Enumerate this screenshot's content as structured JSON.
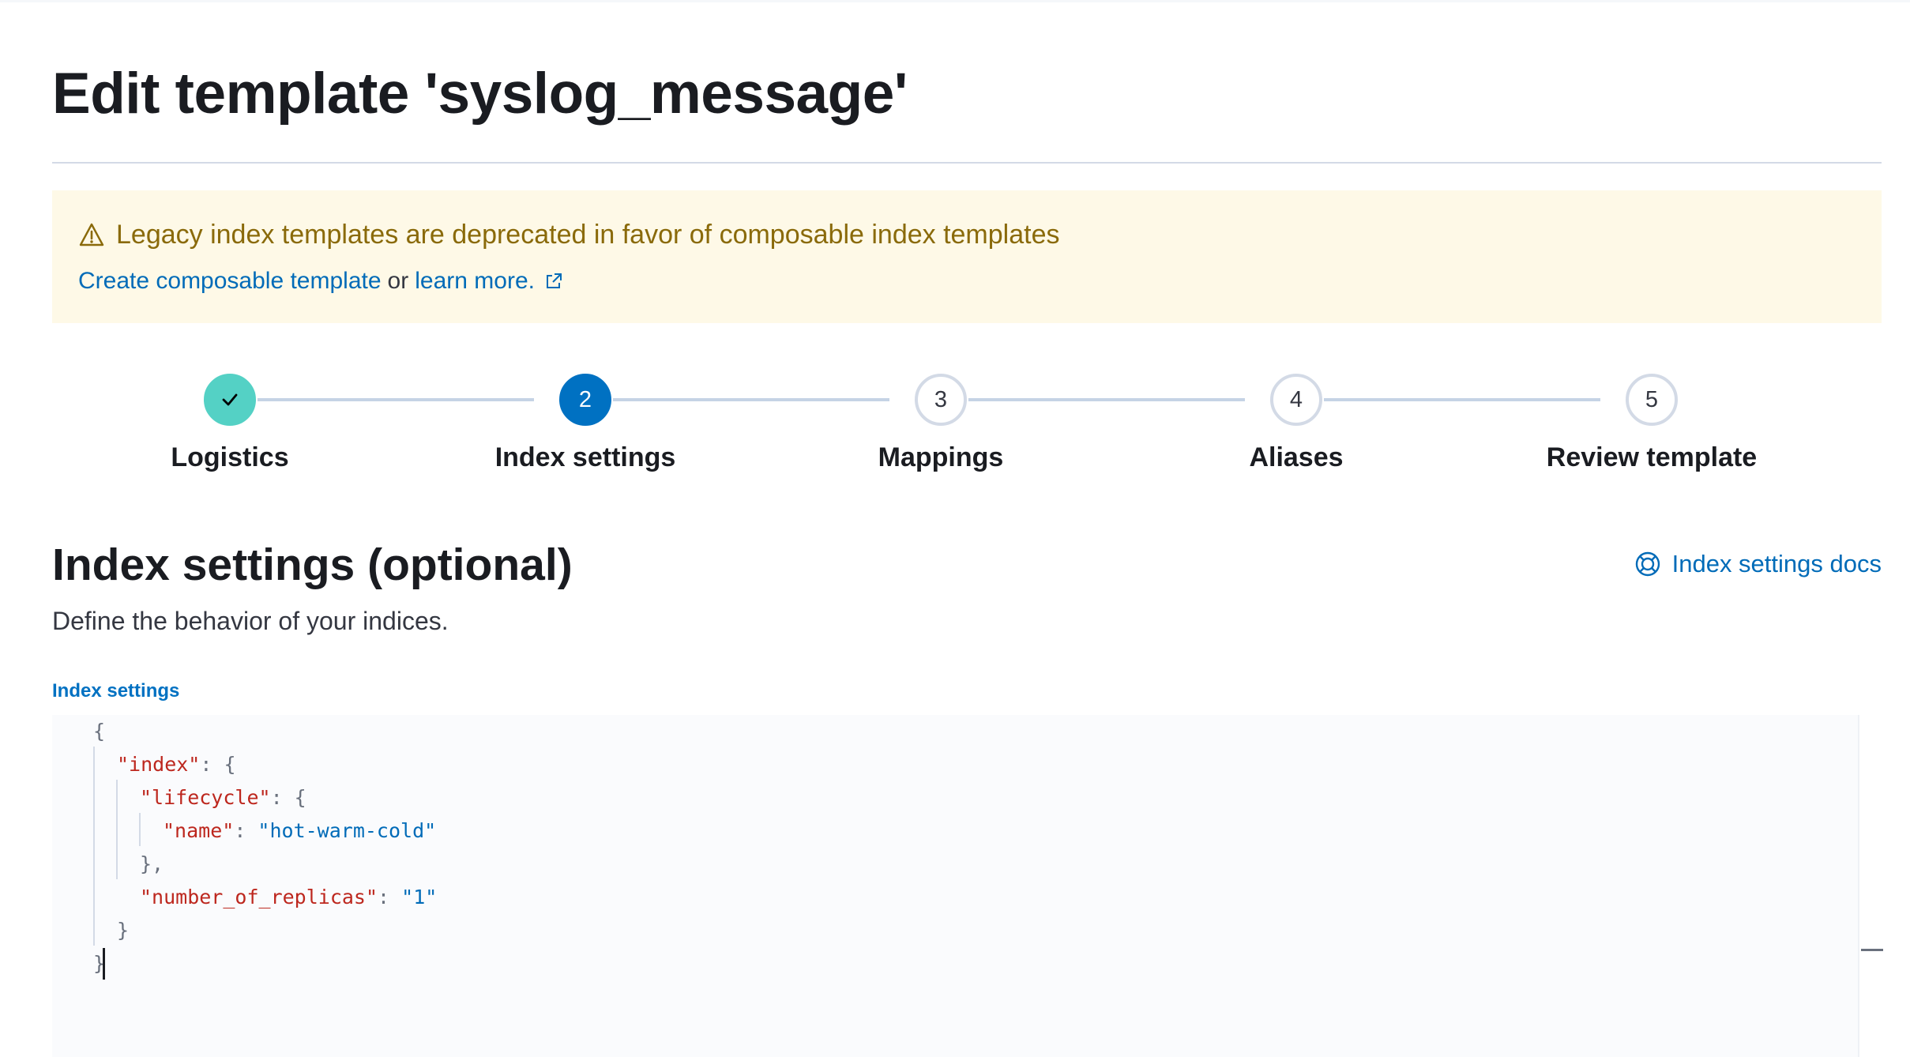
{
  "page": {
    "title": "Edit template 'syslog_message'"
  },
  "callout": {
    "title": "Legacy index templates are deprecated in favor of composable index templates",
    "create_link": "Create composable template",
    "connector": "or",
    "learn_link": "learn more.",
    "icon": "warning-icon",
    "link_icon": "external-link-icon",
    "colors": {
      "background": "#fef9e7",
      "text": "#8a6a0a"
    }
  },
  "steps": [
    {
      "number": "1",
      "label": "Logistics",
      "state": "complete"
    },
    {
      "number": "2",
      "label": "Index settings",
      "state": "current"
    },
    {
      "number": "3",
      "label": "Mappings",
      "state": "incomplete"
    },
    {
      "number": "4",
      "label": "Aliases",
      "state": "incomplete"
    },
    {
      "number": "5",
      "label": "Review template",
      "state": "incomplete"
    }
  ],
  "section": {
    "title": "Index settings (optional)",
    "description": "Define the behavior of your indices.",
    "docs_link": "Index settings docs",
    "docs_icon": "lifebuoy-icon"
  },
  "editor": {
    "label": "Index settings",
    "lines": [
      "{",
      "  \"index\": {",
      "    \"lifecycle\": {",
      "      \"name\": \"hot-warm-cold\"",
      "    },",
      "    \"number_of_replicas\": \"1\"",
      "  }",
      "}"
    ],
    "index_key": "\"index\"",
    "lifecycle_key": "\"lifecycle\"",
    "name_key": "\"name\"",
    "name_value": "\"hot-warm-cold\"",
    "replicas_key": "\"number_of_replicas\"",
    "replicas_value": "\"1\""
  },
  "colors": {
    "accent": "#0071c2",
    "link": "#006bb8",
    "step_complete": "#54d1c5",
    "json_key": "#bd271e",
    "json_string": "#006bb8"
  }
}
